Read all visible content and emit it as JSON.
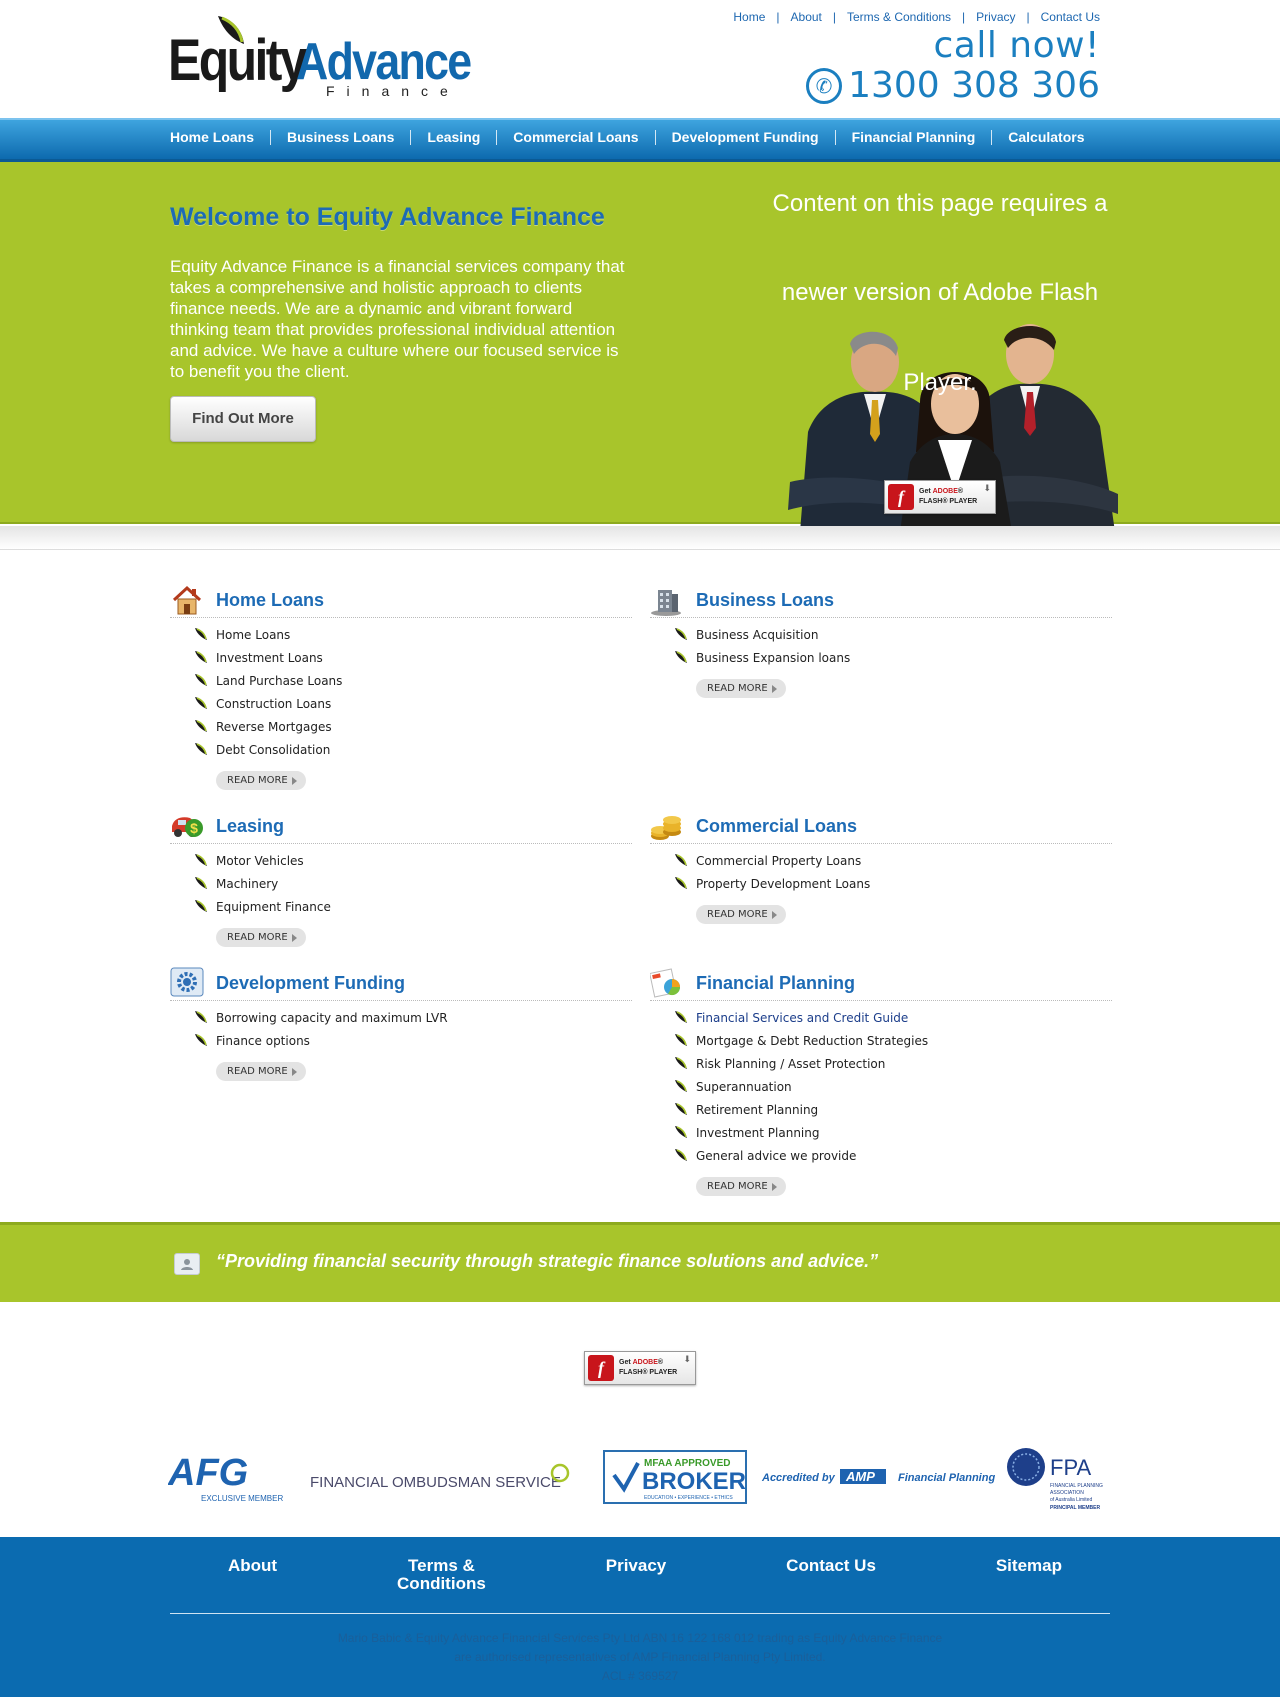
{
  "header": {
    "logo": {
      "word1": "Equity",
      "word2": "Advance",
      "word3": "Finance"
    },
    "top_links": [
      "Home",
      "About",
      "Terms & Conditions",
      "Privacy",
      "Contact Us"
    ],
    "call_now": "call now!",
    "phone": "1300 308 306"
  },
  "main_nav": [
    "Home Loans",
    "Business Loans",
    "Leasing",
    "Commercial Loans",
    "Development Funding",
    "Financial Planning",
    "Calculators"
  ],
  "hero": {
    "title": "Welcome to Equity Advance Finance",
    "body": "Equity Advance Finance is a financial services company that takes a comprehensive and holistic approach to clients finance needs. We are a dynamic and vibrant forward thinking team that provides professional individual attention and advice. We have a culture where our focused service is to benefit you the client.",
    "button": "Find Out More",
    "flash_line1": "Content on this page requires a",
    "flash_line2": "newer version of Adobe Flash",
    "flash_line3": "Player."
  },
  "flash_badge": {
    "get": "Get ",
    "adobe": "ADOBE",
    "reg": "®",
    "player": "FLASH® PLAYER"
  },
  "services": {
    "home_loans": {
      "title": "Home Loans",
      "items": [
        "Home Loans",
        "Investment Loans",
        "Land Purchase Loans",
        "Construction Loans",
        "Reverse Mortgages",
        "Debt Consolidation"
      ],
      "read_more": "READ MORE"
    },
    "business_loans": {
      "title": "Business Loans",
      "items": [
        "Business Acquisition",
        "Business Expansion loans"
      ],
      "read_more": "READ MORE"
    },
    "leasing": {
      "title": "Leasing",
      "items": [
        "Motor Vehicles",
        "Machinery",
        "Equipment Finance"
      ],
      "read_more": "READ MORE"
    },
    "commercial_loans": {
      "title": "Commercial Loans",
      "items": [
        "Commercial Property Loans",
        "Property Development Loans"
      ],
      "read_more": "READ MORE"
    },
    "development_funding": {
      "title": "Development Funding",
      "items": [
        "Borrowing capacity and maximum LVR",
        "Finance options"
      ],
      "read_more": "READ MORE"
    },
    "financial_planning": {
      "title": "Financial Planning",
      "items": [
        "Financial Services and Credit Guide",
        "Mortgage & Debt Reduction Strategies",
        "Risk Planning / Asset Protection",
        "Superannuation",
        "Retirement Planning",
        "Investment Planning",
        "General advice we provide"
      ],
      "read_more": "READ MORE"
    }
  },
  "quote": "“Providing financial security through strategic finance solutions and advice.”",
  "partners": {
    "afg": "AFG",
    "afg_sub": "EXCLUSIVE MEMBER",
    "fos": "FINANCIAL OMBUDSMAN SERVICE",
    "mfaa_top": "MFAA APPROVED",
    "mfaa_main": "BROKER",
    "mfaa_sub": "EDUCATION • EXPERIENCE • ETHICS",
    "amp_pre": "Accredited by",
    "amp": "AMP",
    "amp_post": "Financial Planning",
    "fpa": "FPA",
    "fpa_sub1": "FINANCIAL PLANNING",
    "fpa_sub2": "ASSOCIATION",
    "fpa_sub3": "of Australia Limited",
    "fpa_sub4": "PRINCIPAL MEMBER"
  },
  "footer": {
    "nav": [
      "About",
      "Terms &\nConditions",
      "Privacy",
      "Contact Us",
      "Sitemap"
    ],
    "line1": "Mario Babic & Equity Advance Financial Services Pty Ltd ABN 16 122 168 012 trading as Equity Advance Finance",
    "line2": "are authorised representatives of AMP Financial Planning Pty Limited.",
    "line3": "ACL # 369527"
  },
  "colors": {
    "brand_blue": "#1d6bb5",
    "brand_green": "#a8c52b",
    "footer_blue": "#0b6bb0"
  }
}
